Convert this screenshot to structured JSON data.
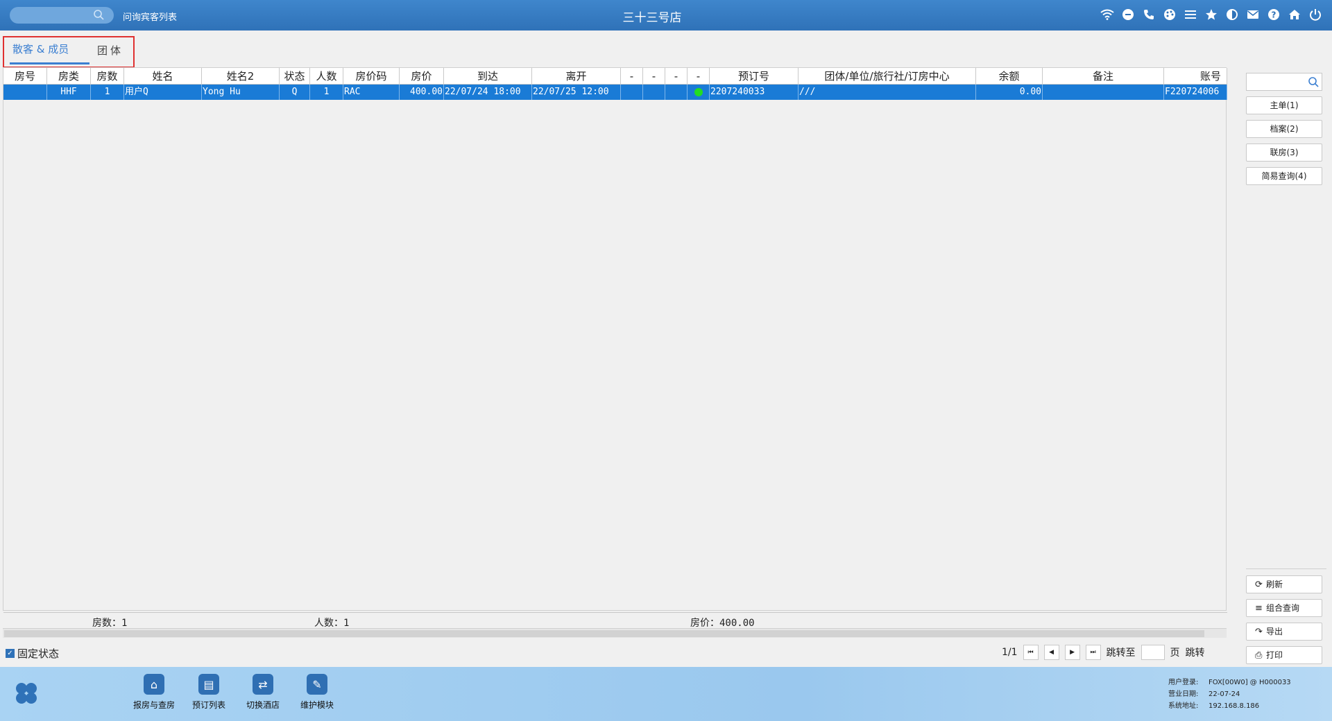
{
  "header": {
    "search_placeholder": "",
    "breadcrumb": "问询宾客列表",
    "title": "三十三号店",
    "icons": [
      "wifi-icon",
      "chat-icon",
      "phone-icon",
      "palette-icon",
      "menu-icon",
      "star-icon",
      "theme-icon",
      "mail-icon",
      "help-icon",
      "home-icon",
      "power-icon"
    ]
  },
  "tabs": [
    {
      "label": "散客 & 成员",
      "active": true
    },
    {
      "label": "团体",
      "active": false
    }
  ],
  "table": {
    "columns": [
      "房号",
      "房类",
      "房数",
      "姓名",
      "姓名2",
      "状态",
      "人数",
      "房价码",
      "房价",
      "到达",
      "离开",
      "-",
      "-",
      "-",
      "-",
      "预订号",
      "团体/单位/旅行社/订房中心",
      "余额",
      "备注",
      "账号"
    ],
    "rows": [
      {
        "room_no": "",
        "room_type": "HHF",
        "rooms": "1",
        "name": "用户Q",
        "name2": "Yong Hu",
        "status": "Q",
        "persons": "1",
        "rate_code": "RAC",
        "rate": "400.00",
        "arrival": "22/07/24 18:00",
        "departure": "22/07/25 12:00",
        "flag1": "",
        "flag2": "",
        "flag3": "",
        "flag4_status": "green",
        "booking_no": "2207240033",
        "group": "///",
        "balance": "0.00",
        "remark": "",
        "account": "F220724006"
      }
    ],
    "footer": {
      "rooms_label": "房数：1",
      "persons_label": "人数：1",
      "rate_label": "房价：400.00"
    }
  },
  "side_panel": {
    "search_placeholder": "",
    "buttons_top": [
      "主单(1)",
      "档案(2)",
      "联房(3)",
      "简易查询(4)"
    ],
    "buttons_bottom": [
      "刷新",
      "组合查询",
      "导出",
      "打印"
    ]
  },
  "status_row": {
    "fixed_state_label": "固定状态",
    "fixed_state_checked": true
  },
  "pager": {
    "page_info": "1/1",
    "jump_to": "跳转至",
    "page_unit": "页",
    "jump_button": "跳转"
  },
  "dock": {
    "apps": [
      "报房与查房",
      "预订列表",
      "切换酒店",
      "维护模块"
    ],
    "user_login_label": "用户登录:",
    "user_login": "FOX[00W0] @ H000033",
    "business_date_label": "营业日期:",
    "business_date": "22-07-24",
    "system_address_label": "系统地址:",
    "system_address": "192.168.8.186"
  },
  "colors": {
    "header_bg": "#2f72b8",
    "tab_active": "#3b7fd1",
    "row_selected": "#1a7bd6",
    "tab_highlight_border": "#e03030",
    "status_dot": "#22dd22"
  }
}
